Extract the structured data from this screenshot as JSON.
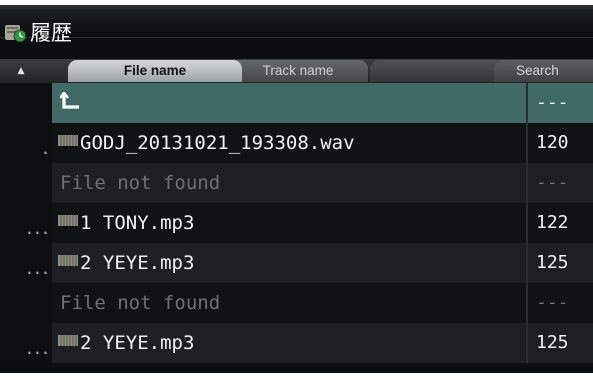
{
  "window": {
    "title": "履歴"
  },
  "tabs": {
    "sort_toggle": "▲",
    "file_name": "File name",
    "track_name": "Track name",
    "search": "Search"
  },
  "list": {
    "parent_icon": "parent-folder-arrow-icon",
    "rows": [
      {
        "marker": "",
        "name": "",
        "bpm": "---"
      },
      {
        "marker": ".",
        "name": "GODJ_20131021_193308.wav",
        "bpm": "120"
      },
      {
        "marker": "",
        "name": "File not found",
        "bpm": "---"
      },
      {
        "marker": "...",
        "name": "1 TONY.mp3",
        "bpm": "122"
      },
      {
        "marker": "...",
        "name": "2 YEYE.mp3",
        "bpm": "125"
      },
      {
        "marker": "",
        "name": "File not found",
        "bpm": "---"
      },
      {
        "marker": "...",
        "name": "2 YEYE.mp3",
        "bpm": "125"
      }
    ]
  },
  "colors": {
    "highlight_row": "#3f6a65",
    "row_dark": "#101214",
    "row_alt": "#1c2022",
    "active_tab": "#c8cccf"
  }
}
